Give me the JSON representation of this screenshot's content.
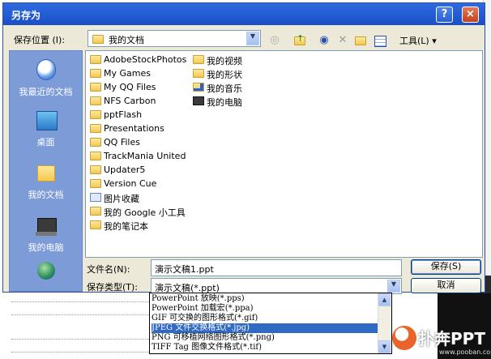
{
  "dialog": {
    "title": "另存为",
    "help_button": "?",
    "close_button": "×"
  },
  "location": {
    "label": "保存位置 (I):",
    "value": "我的文档"
  },
  "toolbar": {
    "tools_label": "工具(L)",
    "icons": [
      "back-icon",
      "up-folder-icon",
      "search-web-icon",
      "delete-icon",
      "new-folder-icon",
      "views-icon"
    ]
  },
  "places": [
    {
      "label": "我最近的文档",
      "icon": "recent-documents-icon"
    },
    {
      "label": "桌面",
      "icon": "desktop-icon"
    },
    {
      "label": "我的文档",
      "icon": "my-documents-icon"
    },
    {
      "label": "我的电脑",
      "icon": "my-computer-icon"
    },
    {
      "label": "",
      "icon": "network-places-icon"
    }
  ],
  "files_col1": [
    {
      "name": "AdobeStockPhotos",
      "icon": "folder-icon"
    },
    {
      "name": "My Games",
      "icon": "folder-icon"
    },
    {
      "name": "My QQ Files",
      "icon": "folder-icon"
    },
    {
      "name": "NFS Carbon",
      "icon": "folder-icon"
    },
    {
      "name": "pptFlash",
      "icon": "folder-icon"
    },
    {
      "name": "Presentations",
      "icon": "folder-icon"
    },
    {
      "name": "QQ Files",
      "icon": "folder-icon"
    },
    {
      "name": "TrackMania United",
      "icon": "folder-icon"
    },
    {
      "name": "Updater5",
      "icon": "folder-icon"
    },
    {
      "name": "Version Cue",
      "icon": "folder-icon"
    },
    {
      "name": "图片收藏",
      "icon": "pictures-folder-icon"
    },
    {
      "name": "我的 Google 小工具",
      "icon": "folder-icon"
    },
    {
      "name": "我的笔记本",
      "icon": "folder-icon"
    }
  ],
  "files_col2": [
    {
      "name": "我的视频",
      "icon": "folder-icon"
    },
    {
      "name": "我的形状",
      "icon": "folder-icon"
    },
    {
      "name": "我的音乐",
      "icon": "music-folder-icon"
    },
    {
      "name": "我的电脑",
      "icon": "computer-icon"
    }
  ],
  "filename": {
    "label": "文件名(N):",
    "value": "演示文稿1.ppt"
  },
  "filetype": {
    "label": "保存类型(T):",
    "value": "演示文稿(*.ppt)",
    "options": [
      "PowerPoint 放映(*.pps)",
      "PowerPoint 加载宏(*.ppa)",
      "GIF 可交换的图形格式(*.gif)",
      "JPEG 文件交换格式(*.jpg)",
      "PNG 可移植网络图形格式(*.png)",
      "TIFF Tag 图像文件格式(*.tif)"
    ],
    "selected_index": 3
  },
  "buttons": {
    "save": "保存(S)",
    "cancel": "取消"
  },
  "watermark": {
    "brand": "扑奔PPT",
    "url": "www.pooban.com"
  }
}
